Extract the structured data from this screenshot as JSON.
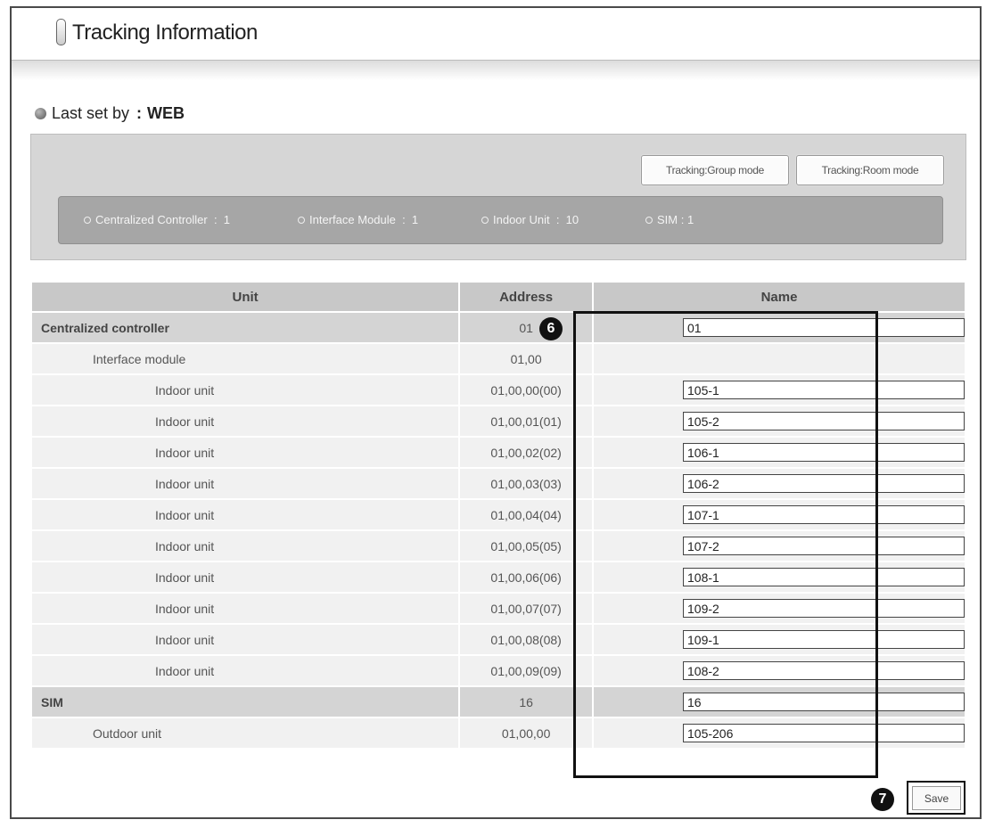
{
  "header": {
    "title": "Tracking Information"
  },
  "last_set": {
    "label": "Last set by",
    "separator": ":",
    "value": "WEB"
  },
  "mode_buttons": {
    "group": "Tracking:Group mode",
    "room": "Tracking:Room mode"
  },
  "counts": [
    {
      "label": "Centralized Controller",
      "value": "1"
    },
    {
      "label": "Interface Module",
      "value": "1"
    },
    {
      "label": "Indoor Unit",
      "value": "10"
    },
    {
      "label": "SIM",
      "value": "1"
    }
  ],
  "table": {
    "headers": {
      "unit": "Unit",
      "address": "Address",
      "name": "Name"
    },
    "rows": [
      {
        "level": 0,
        "unit": "Centralized controller",
        "address": "01",
        "name": "01"
      },
      {
        "level": 1,
        "unit": "Interface module",
        "address": "01,00",
        "name": null
      },
      {
        "level": 2,
        "unit": "Indoor unit",
        "address": "01,00,00(00)",
        "name": "105-1"
      },
      {
        "level": 2,
        "unit": "Indoor unit",
        "address": "01,00,01(01)",
        "name": "105-2"
      },
      {
        "level": 2,
        "unit": "Indoor unit",
        "address": "01,00,02(02)",
        "name": "106-1"
      },
      {
        "level": 2,
        "unit": "Indoor unit",
        "address": "01,00,03(03)",
        "name": "106-2"
      },
      {
        "level": 2,
        "unit": "Indoor unit",
        "address": "01,00,04(04)",
        "name": "107-1"
      },
      {
        "level": 2,
        "unit": "Indoor unit",
        "address": "01,00,05(05)",
        "name": "107-2"
      },
      {
        "level": 2,
        "unit": "Indoor unit",
        "address": "01,00,06(06)",
        "name": "108-1"
      },
      {
        "level": 2,
        "unit": "Indoor unit",
        "address": "01,00,07(07)",
        "name": "109-2"
      },
      {
        "level": 2,
        "unit": "Indoor unit",
        "address": "01,00,08(08)",
        "name": "109-1"
      },
      {
        "level": 2,
        "unit": "Indoor unit",
        "address": "01,00,09(09)",
        "name": "108-2"
      },
      {
        "level": 0,
        "unit": "SIM",
        "address": "16",
        "name": "16"
      },
      {
        "level": 1,
        "unit": "Outdoor unit",
        "address": "01,00,00",
        "name": "105-206"
      }
    ]
  },
  "markers": {
    "name_column": "6",
    "save": "7"
  },
  "save_label": "Save"
}
